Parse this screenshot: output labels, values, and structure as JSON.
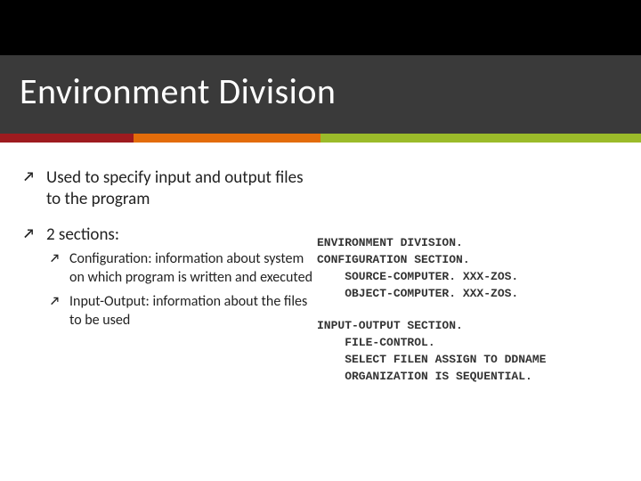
{
  "title": "Environment Division",
  "bullets": {
    "b1": "Used to specify input and output files to the program",
    "b2": "2 sections:",
    "sub1": "Configuration: information about system on which program is written and executed",
    "sub2": "Input-Output: information about the files to be used"
  },
  "code": {
    "l1": "ENVIRONMENT DIVISION.",
    "l2": "CONFIGURATION SECTION.",
    "l3": "    SOURCE-COMPUTER. XXX-ZOS.",
    "l4": "    OBJECT-COMPUTER. XXX-ZOS.",
    "l5": "INPUT-OUTPUT SECTION.",
    "l6": "    FILE-CONTROL.",
    "l7": "    SELECT FILEN ASSIGN TO DDNAME",
    "l8": "    ORGANIZATION IS SEQUENTIAL."
  }
}
